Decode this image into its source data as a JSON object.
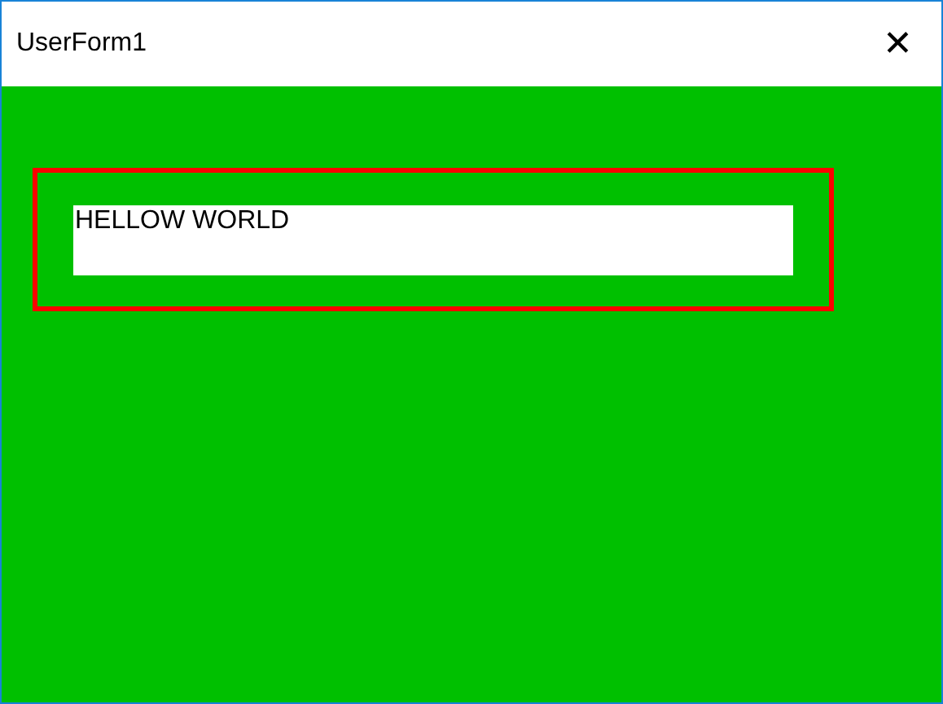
{
  "window": {
    "title": "UserForm1",
    "close": "✕"
  },
  "textbox": {
    "value": "HELLOW WORLD"
  }
}
